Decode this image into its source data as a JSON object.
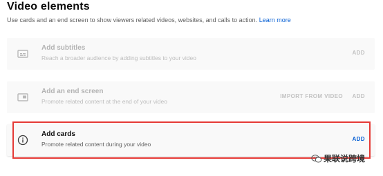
{
  "section": {
    "title": "Video elements",
    "description": "Use cards and an end screen to show viewers related videos, websites, and calls to action.",
    "learn_more": "Learn more"
  },
  "rows": [
    {
      "name": "Add subtitles",
      "description": "Reach a broader audience by adding subtitles to your video",
      "icon": "subtitles-icon",
      "add_label": "ADD",
      "enabled": false
    },
    {
      "name": "Add an end screen",
      "description": "Promote related content at the end of your video",
      "icon": "end-screen-icon",
      "import_label": "IMPORT FROM VIDEO",
      "add_label": "ADD",
      "enabled": false
    },
    {
      "name": "Add cards",
      "description": "Promote related content during your video",
      "icon": "info-icon",
      "add_label": "ADD",
      "enabled": true,
      "highlighted": true
    }
  ],
  "watermark": {
    "text": "果联说跨境",
    "icon": "wechat-icon"
  },
  "colors": {
    "accent": "#065fd4",
    "highlight": "#e53935",
    "row_bg": "#f9f9f9"
  }
}
